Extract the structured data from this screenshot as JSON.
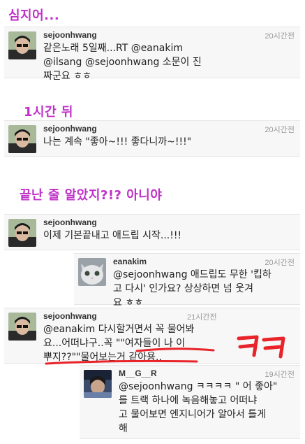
{
  "captions": [
    "심지어...",
    "1시간 뒤",
    "끝난 줄 알았지?!? 아니야"
  ],
  "tweets": [
    {
      "user": "sejoonhwang",
      "time": "20시간전",
      "lines": [
        "같은노래 5일째...RT @eanakim",
        "@ilsang @sejoonhwang 소문이 진",
        "짜군요 ㅎㅎ"
      ]
    },
    {
      "user": "sejoonhwang",
      "time": "20시간전",
      "lines": [
        "나는 계속 \"좋아~!!! 좋다니까~!!!\""
      ]
    },
    {
      "user": "sejoonhwang",
      "time": "",
      "lines": [
        "이제 기본끝내고 애드립 시작...!!!"
      ]
    },
    {
      "user": "eanakim",
      "time": "20시간전",
      "lines": [
        "@sejoonhwang 애드립도 무한 '킵하",
        "고 다시' 인가요? 상상하면 넘 웃겨",
        "요 ㅎㅎ"
      ]
    },
    {
      "user": "sejoonhwang",
      "time": "21시간전",
      "lines": [
        "@eanakim 다시할거면서 꼭 물어봐",
        "요...어떠냐구..꼭 \"\"여자들이 나 이",
        "뿌지??\"\"물어보는거 같아용.."
      ]
    },
    {
      "user": "M__G__R",
      "time": "19시간전",
      "lines": [
        "@sejoonhwang ㅋㅋㅋㅋ \" 어 좋아\"",
        "를 트랙 하나에  녹음해놓고 어떠냐",
        "고 물어보면 엔지니어가 알아서 틀게",
        "해"
      ]
    }
  ],
  "annotation": "ㅋㅋ",
  "colors": {
    "caption": "#c030c8",
    "annotation": "#e8242a",
    "underline": "#e8242a"
  }
}
